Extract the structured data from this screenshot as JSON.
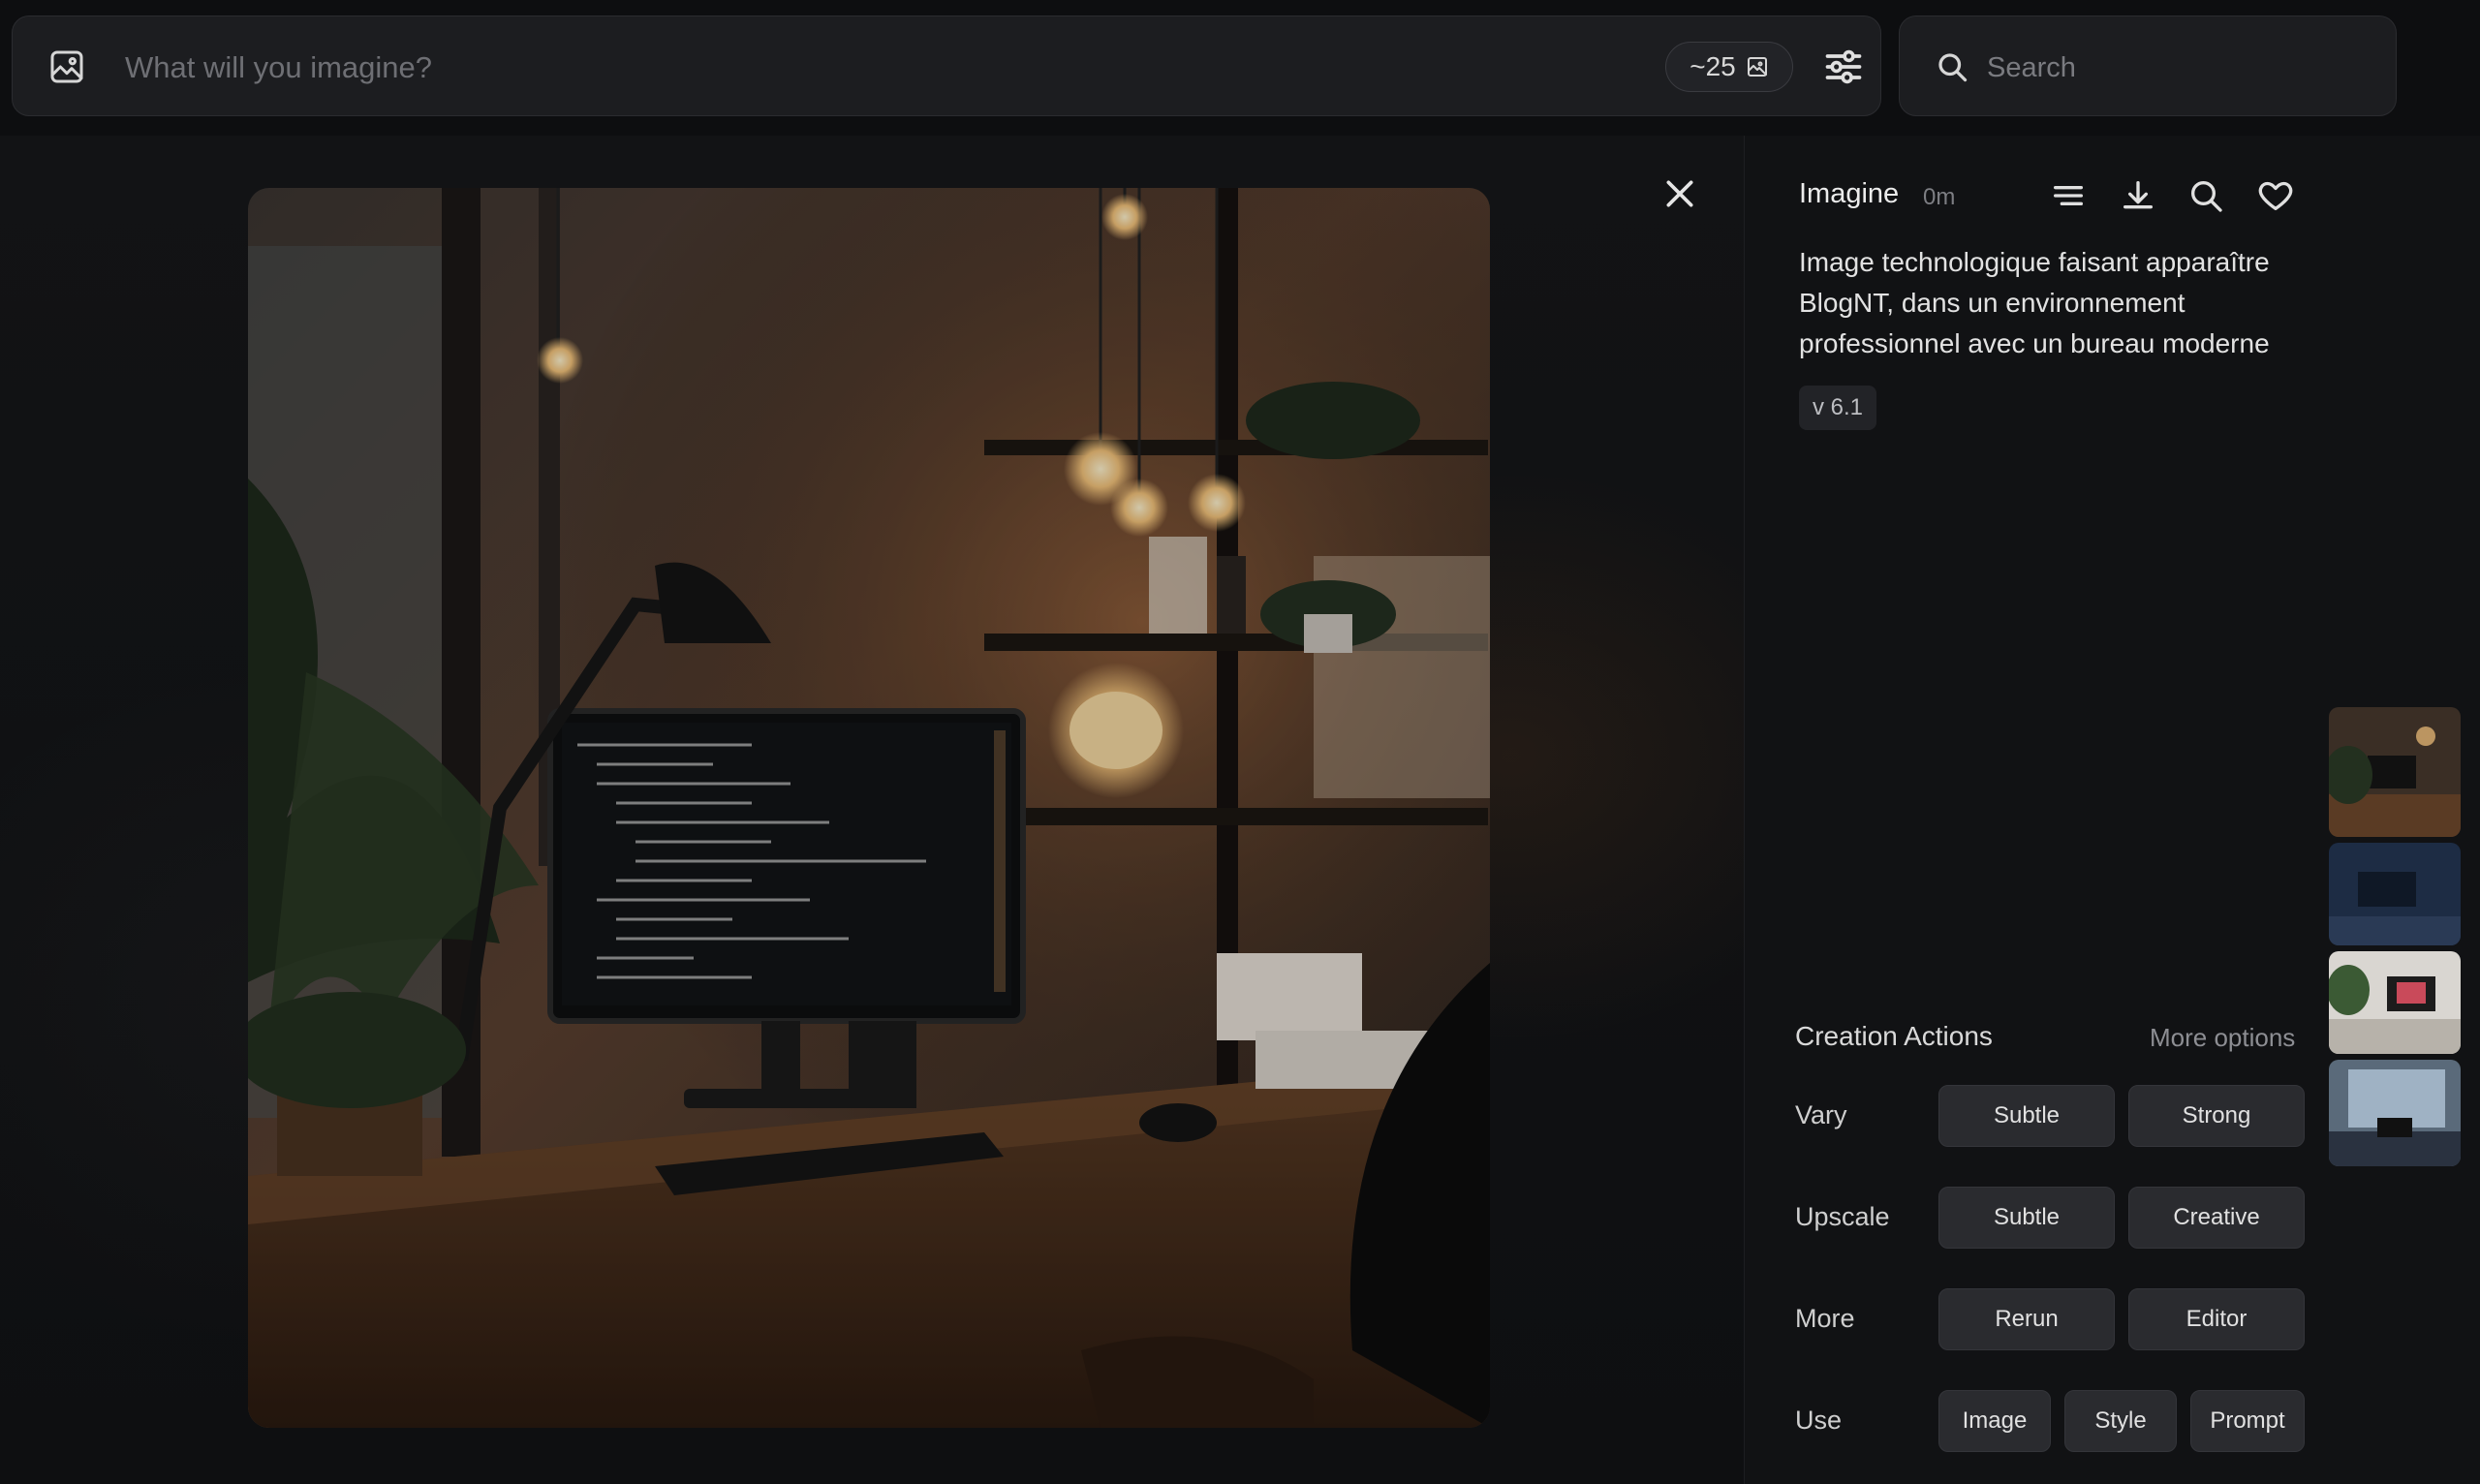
{
  "prompt_bar": {
    "placeholder": "What will you imagine?",
    "credits": "~25",
    "icons": [
      "image-icon",
      "image-small-icon",
      "sliders-icon"
    ]
  },
  "search": {
    "placeholder": "Search",
    "icon": "search-icon"
  },
  "detail": {
    "title": "Imagine",
    "time": "0m",
    "prompt": "Image technologique faisant apparaître BlogNT, dans un environnement professionnel avec un bureau moderne",
    "version": "v 6.1",
    "icons": [
      "list-icon",
      "download-icon",
      "search-icon",
      "heart-icon",
      "close-icon"
    ]
  },
  "actions": {
    "title": "Creation Actions",
    "more_options": "More options",
    "rows": [
      {
        "label": "Vary",
        "buttons": [
          "Subtle",
          "Strong"
        ]
      },
      {
        "label": "Upscale",
        "buttons": [
          "Subtle",
          "Creative"
        ]
      },
      {
        "label": "More",
        "buttons": [
          "Rerun",
          "Editor"
        ]
      },
      {
        "label": "Use",
        "buttons": [
          "Image",
          "Style",
          "Prompt"
        ]
      }
    ]
  },
  "colors": {
    "background": "#0d0e10",
    "panel": "#111214",
    "button": "#2a2b2f",
    "text": "#e6e6e6",
    "muted": "#7d7e83"
  }
}
